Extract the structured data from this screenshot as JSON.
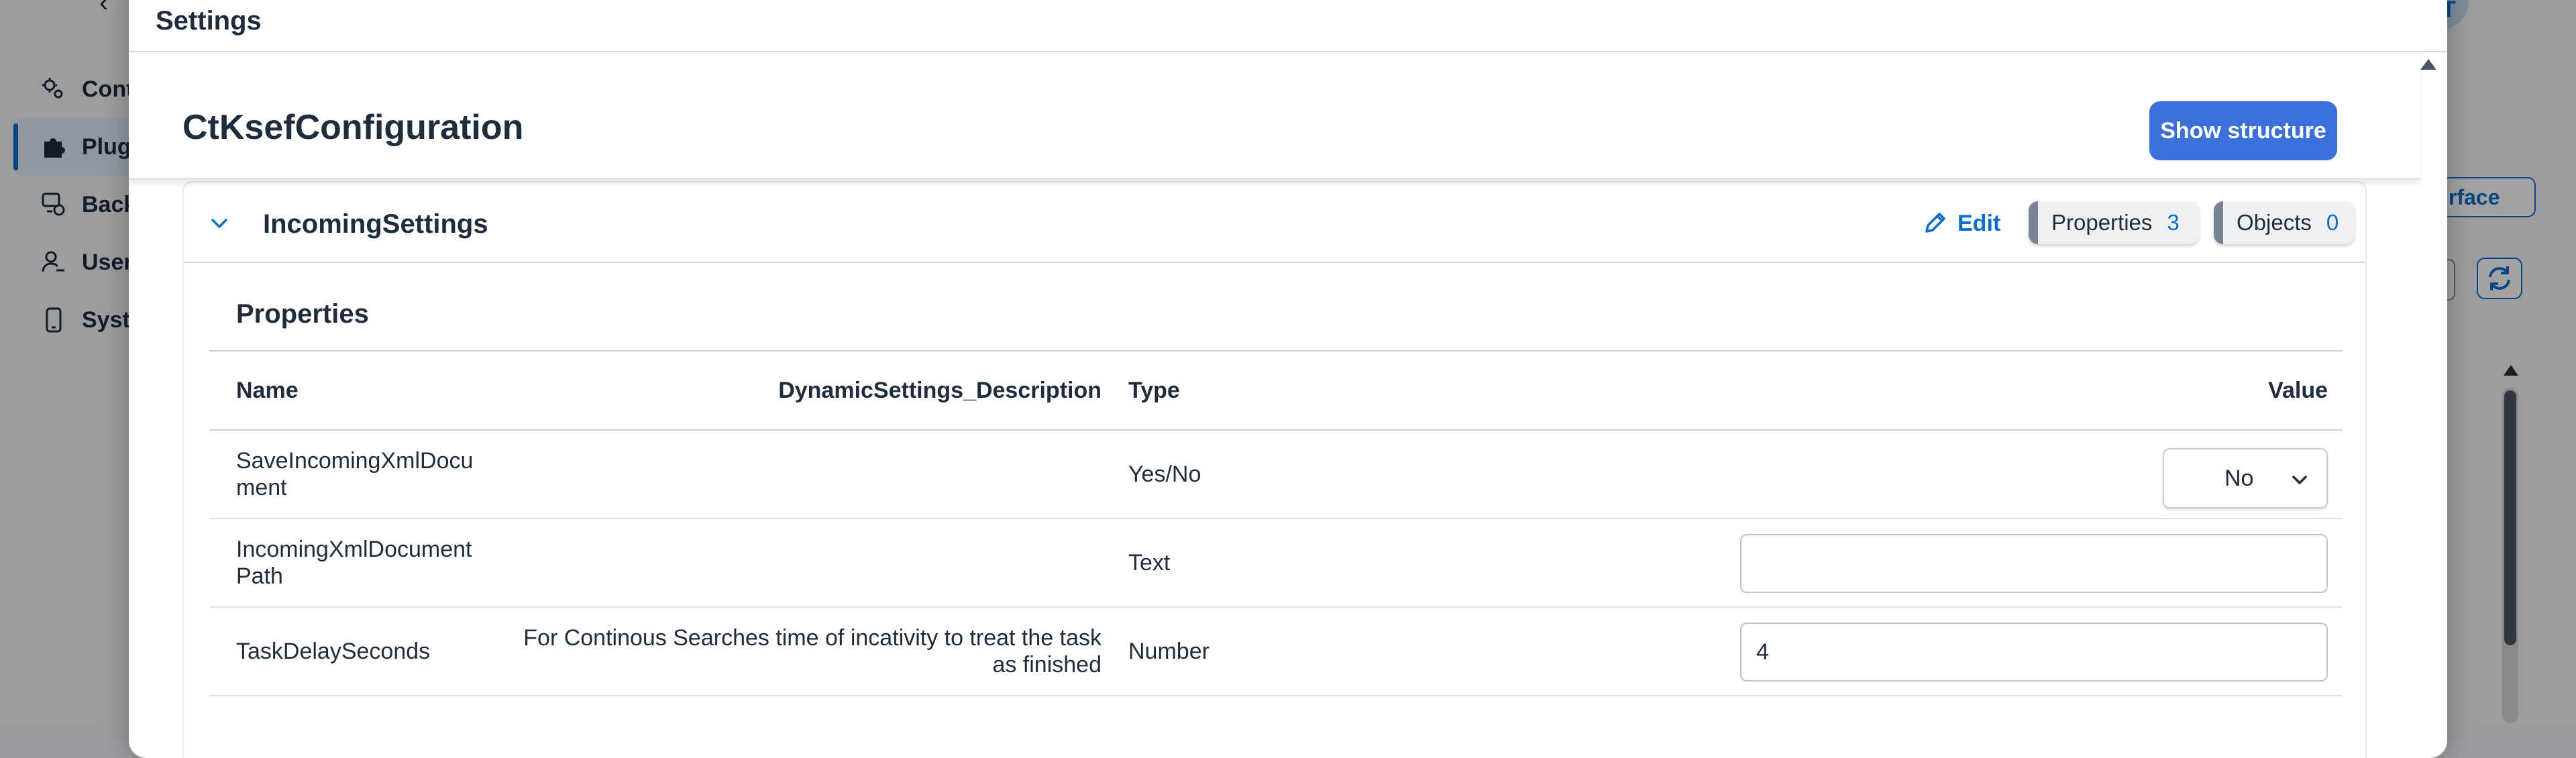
{
  "background": {
    "nav_items": [
      {
        "label": "Cont",
        "icon": "gears-icon"
      },
      {
        "label": "Plug",
        "icon": "puzzle-icon",
        "active": true
      },
      {
        "label": "Back",
        "icon": "backend-icon"
      },
      {
        "label": "User",
        "icon": "user-settings-icon"
      },
      {
        "label": "Syst",
        "icon": "device-icon"
      }
    ],
    "avatar_initials": "CT",
    "surface_button_label": "rface"
  },
  "dialog": {
    "title": "Settings",
    "config_name": "CtKsefConfiguration",
    "show_structure_label": "Show structure",
    "panel": {
      "title": "IncomingSettings",
      "edit_label": "Edit",
      "properties_badge": {
        "label": "Properties",
        "count": "3"
      },
      "objects_badge": {
        "label": "Objects",
        "count": "0"
      },
      "section_title": "Properties",
      "table": {
        "headers": {
          "name": "Name",
          "description": "DynamicSettings_Description",
          "type": "Type",
          "value": "Value"
        },
        "rows": [
          {
            "name": "SaveIncomingXmlDocument",
            "name_display": "SaveIncomingXmlDocu\nment",
            "description": "",
            "type": "Yes/No",
            "value": "No",
            "control": "select"
          },
          {
            "name": "IncomingXmlDocumentPath",
            "name_display": "IncomingXmlDocument\nPath",
            "description": "",
            "type": "Text",
            "value": "",
            "control": "input"
          },
          {
            "name": "TaskDelaySeconds",
            "name_display": "TaskDelaySeconds",
            "description": "For Continous Searches time of incativity to treat the task as finished",
            "type": "Number",
            "value": "4",
            "control": "input"
          }
        ]
      }
    }
  },
  "colors": {
    "accent": "#0a6ed1",
    "primary_button": "#3b6fd9",
    "text": "#1d2d3e"
  }
}
